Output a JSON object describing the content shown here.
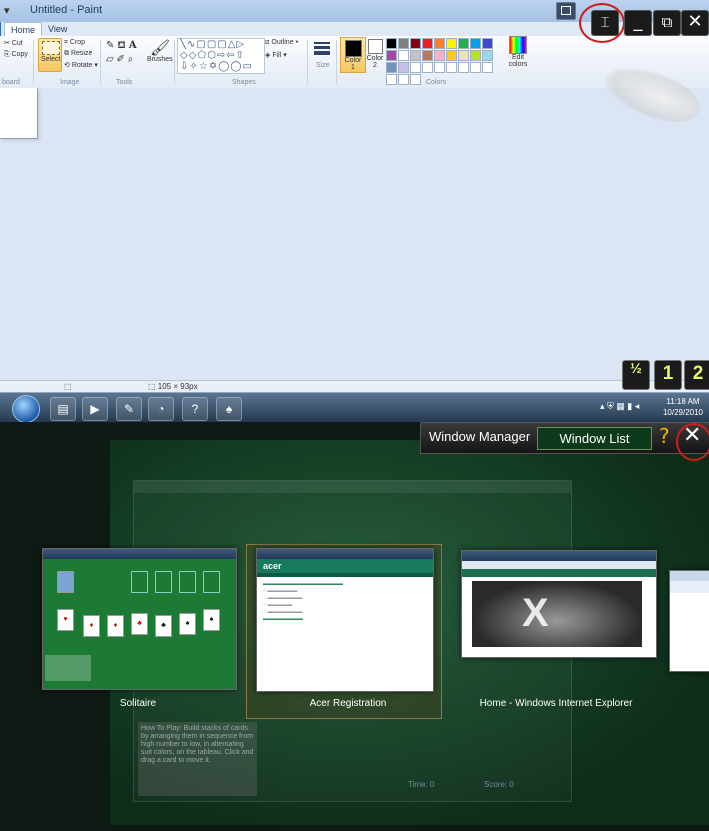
{
  "paint": {
    "title": "Untitled - Paint",
    "tabs": [
      "Home",
      "View"
    ],
    "clipboard": {
      "cut": "Cut",
      "copy": "Copy",
      "label": "board"
    },
    "image": {
      "select": "Select",
      "crop": "Crop",
      "resize": "Resize",
      "rotate": "Rotate",
      "label": "Image"
    },
    "tools_label": "Tools",
    "brushes": "Brushes",
    "shapes": {
      "outline": "Outline",
      "fill": "Fill",
      "label": "Shapes"
    },
    "size": "Size",
    "color1": "Color 1",
    "color2": "Color 2",
    "colors_label": "Colors",
    "edit_colors": "Edit colors",
    "palette": [
      "#000000",
      "#7f7f7f",
      "#880015",
      "#ed1c24",
      "#ff7f27",
      "#fff200",
      "#22b14c",
      "#00a2e8",
      "#3f48cc",
      "#a349a4",
      "#ffffff",
      "#c3c3c3",
      "#b97a57",
      "#ffaec9",
      "#ffc90e",
      "#efe4b0",
      "#b5e61d",
      "#99d9ea",
      "#7092be",
      "#c8bfe7",
      "#ffffff",
      "#ffffff",
      "#ffffff",
      "#ffffff",
      "#ffffff",
      "#ffffff",
      "#ffffff",
      "#ffffff",
      "#ffffff",
      "#ffffff"
    ],
    "status_size": "105 × 93px"
  },
  "overlay": {
    "snap_label": "½",
    "one_label": "1",
    "two_label": "2"
  },
  "taskbar": {
    "time": "11:18 AM",
    "date": "10/29/2010"
  },
  "window_manager": {
    "title": "Window Manager",
    "list_button": "Window List",
    "help": "?",
    "close": "✕",
    "windows": [
      {
        "label": "Solitaire"
      },
      {
        "label": "Acer Registration"
      },
      {
        "label": "Home - Windows Internet Explorer"
      }
    ],
    "ghost_help": "How To Play: Build stacks of cards by arranging them in sequence from high number to low, in alternating suit colors, on the tableau. Click and drag a card to move it.",
    "ghost_time": "Time: 0",
    "ghost_score": "Score: 0"
  }
}
